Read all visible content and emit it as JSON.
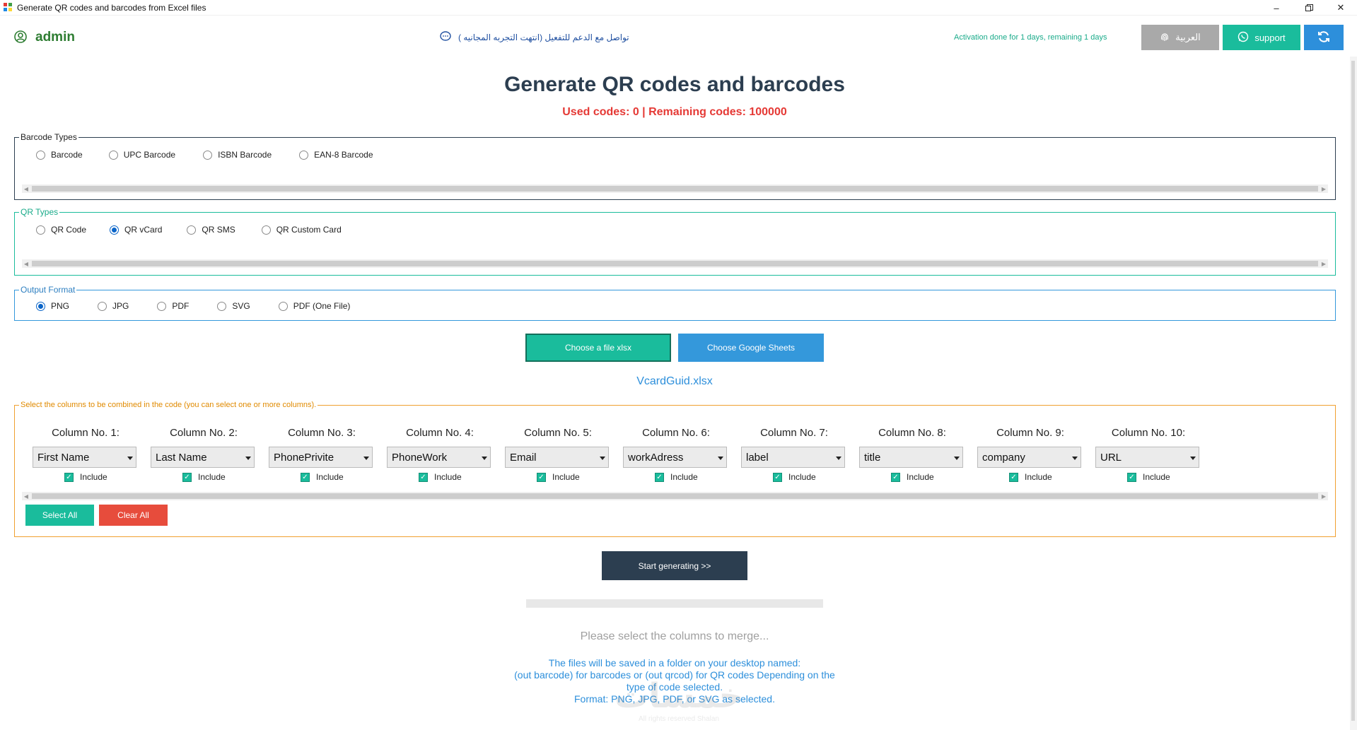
{
  "window": {
    "title": "Generate QR codes and barcodes from Excel files",
    "controls": [
      "minimize-icon",
      "restore-icon",
      "close-icon"
    ]
  },
  "header": {
    "username": "admin",
    "support_message": "تواصل مع الدعم للتفعيل (انتهت التجربه المجانيه )",
    "activation": "Activation done for 1 days, remaining 1 days",
    "lang_button": "العربية",
    "support_button": "support",
    "icons": {
      "user": "user-circle-icon",
      "chat": "chat-bubble-icon",
      "lang": "fingerprint-icon",
      "support": "whatsapp-icon",
      "refresh": "refresh-icon"
    }
  },
  "main": {
    "title": "Generate QR codes and barcodes",
    "codes_status": "Used codes: 0 | Remaining codes: 100000"
  },
  "barcode_types": {
    "legend": "Barcode Types",
    "options": [
      "Barcode",
      "UPC Barcode",
      "ISBN Barcode",
      "EAN-8 Barcode"
    ],
    "selected": null
  },
  "qr_types": {
    "legend": "QR Types",
    "options": [
      "QR Code",
      "QR vCard",
      "QR SMS",
      "QR Custom Card"
    ],
    "selected": "QR vCard"
  },
  "output_format": {
    "legend": "Output Format",
    "options": [
      "PNG",
      "JPG",
      "PDF",
      "SVG",
      "PDF (One File)"
    ],
    "selected": "PNG"
  },
  "file": {
    "choose_xlsx": "Choose a file xlsx",
    "choose_google": "Choose Google Sheets",
    "selected_file": "VcardGuid.xlsx"
  },
  "columns": {
    "legend": "Select the columns to be combined in the code (you can select one or more columns).",
    "items": [
      {
        "label": "Column No. 1:",
        "value": "First Name",
        "include": "Include"
      },
      {
        "label": "Column No. 2:",
        "value": "Last Name",
        "include": "Include"
      },
      {
        "label": "Column No. 3:",
        "value": "PhonePrivite",
        "include": "Include"
      },
      {
        "label": "Column No. 4:",
        "value": "PhoneWork",
        "include": "Include"
      },
      {
        "label": "Column No. 5:",
        "value": "Email",
        "include": "Include"
      },
      {
        "label": "Column No. 6:",
        "value": "workAdress",
        "include": "Include"
      },
      {
        "label": "Column No. 7:",
        "value": "label",
        "include": "Include"
      },
      {
        "label": "Column No. 8:",
        "value": "title",
        "include": "Include"
      },
      {
        "label": "Column No. 9:",
        "value": "company",
        "include": "Include"
      },
      {
        "label": "Column No. 10:",
        "value": "URL",
        "include": "Include"
      }
    ],
    "select_all": "Select All",
    "clear_all": "Clear All"
  },
  "actions": {
    "start": "Start generating >>",
    "hint": "Please select the columns to merge...",
    "info_lines": [
      "The files will be saved in a folder on your desktop named:",
      "(out barcode) for barcodes or (out qrcod) for QR codes Depending on the",
      "type of code selected.",
      "Format: PNG, JPG, PDF, or SVG as selected."
    ]
  },
  "watermark": {
    "logo": "خمسات",
    "rights": "All rights reserved Shalan"
  },
  "colors": {
    "accent_green": "#1abc9c",
    "accent_blue": "#3498db",
    "danger_red": "#e74c3c",
    "dark_navy": "#2c3e50",
    "warning_orange": "#f0a030"
  }
}
